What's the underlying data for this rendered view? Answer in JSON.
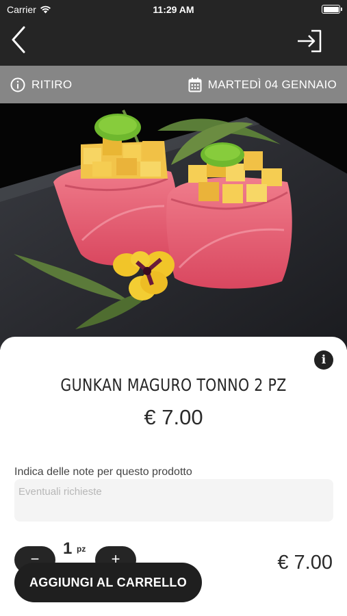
{
  "status_bar": {
    "carrier": "Carrier",
    "time": "11:29 AM",
    "icons": [
      "wifi-icon",
      "battery-icon"
    ]
  },
  "nav": {
    "back_icon": "chevron-left-icon",
    "login_icon": "sign-in-icon"
  },
  "info_bar": {
    "mode_label": "RITIRO",
    "mode_icon": "info-circle-icon",
    "date_label": "MARTEDÌ 04 GENNAIO",
    "date_icon": "calendar-icon"
  },
  "product": {
    "image_icon": "sushi-photo",
    "name": "GUNKAN MAGURO TONNO 2 PZ",
    "price": "€ 7.00",
    "info_icon": "info-icon"
  },
  "notes": {
    "label": "Indica delle note per questo prodotto",
    "placeholder": "Eventuali richieste",
    "value": ""
  },
  "quantity": {
    "value": "1",
    "unit": "pz",
    "minus_label": "−",
    "plus_label": "+"
  },
  "cart": {
    "total": "€ 7.00",
    "add_label": "AGGIUNGI AL CARRELLO"
  },
  "colors": {
    "topbar": "#252525",
    "infobar": "#868686",
    "button": "#1f1f1f",
    "input_bg": "#f4f4f4"
  }
}
